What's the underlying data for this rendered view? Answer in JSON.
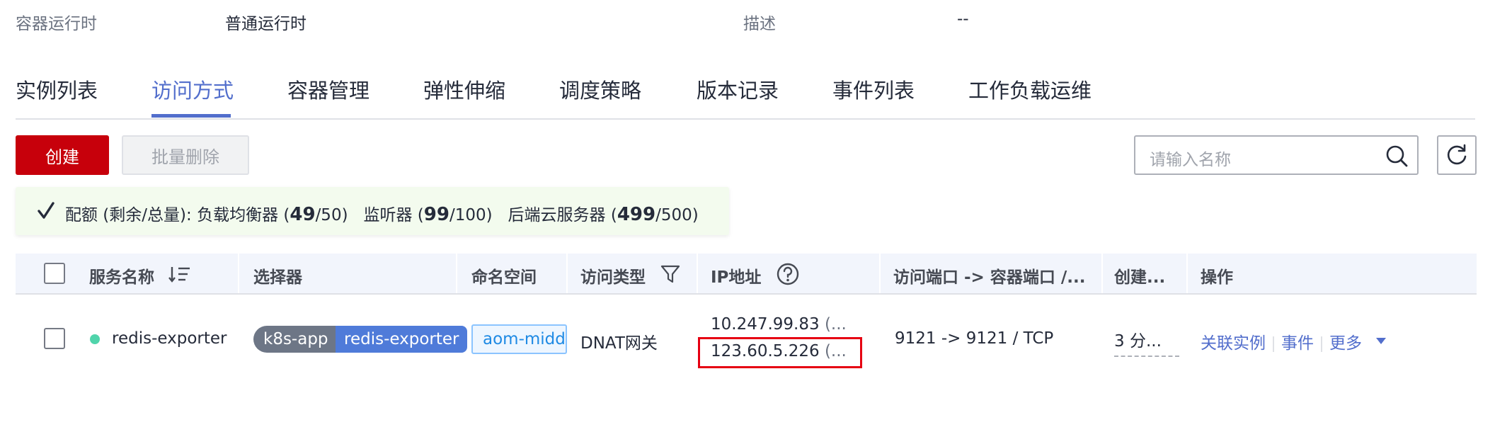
{
  "info": {
    "runtime_label": "容器运行时",
    "runtime_value": "普通运行时",
    "desc_label": "描述",
    "desc_value": "--"
  },
  "tabs": [
    {
      "label": "实例列表",
      "active": false
    },
    {
      "label": "访问方式",
      "active": true
    },
    {
      "label": "容器管理",
      "active": false
    },
    {
      "label": "弹性伸缩",
      "active": false
    },
    {
      "label": "调度策略",
      "active": false
    },
    {
      "label": "版本记录",
      "active": false
    },
    {
      "label": "事件列表",
      "active": false
    },
    {
      "label": "工作负载运维",
      "active": false
    }
  ],
  "toolbar": {
    "create_label": "创建",
    "batch_delete_label": "批量删除",
    "search_placeholder": "请输入名称",
    "search_icon": "search-icon",
    "refresh_icon": "refresh-icon"
  },
  "quota": {
    "prefix": "配额 (剩余/总量):",
    "lb_label": "负载均衡器 (",
    "lb_remaining": "49",
    "lb_total": "/50)",
    "listener_label": "监听器 (",
    "listener_remaining": "99",
    "listener_total": "/100)",
    "backend_label": "后端云服务器 (",
    "backend_remaining": "499",
    "backend_total": "/500)"
  },
  "table": {
    "headers": {
      "name": "服务名称",
      "selector": "选择器",
      "namespace": "命名空间",
      "access_type": "访问类型",
      "ip": "IP地址",
      "ports": "访问端口 -> 容器端口 /...",
      "created": "创建...",
      "actions": "操作"
    },
    "rows": [
      {
        "status_color": "#50d4ab",
        "name": "redis-exporter",
        "selector_key": "k8s-app",
        "selector_value": "redis-exporter",
        "namespace": "aom-middle",
        "access_type": "DNAT网关",
        "ip_internal": "10.247.99.83",
        "ip_internal_suffix": " (...",
        "ip_external": "123.60.5.226",
        "ip_external_suffix": " (...",
        "ports": "9121 -> 9121 / TCP",
        "created": "3 分...",
        "actions": {
          "related_instances": "关联实例",
          "events": "事件",
          "more": "更多"
        }
      }
    ]
  },
  "colors": {
    "primary": "#c7000b",
    "accent": "#526ecc",
    "highlight": "#e60012"
  }
}
